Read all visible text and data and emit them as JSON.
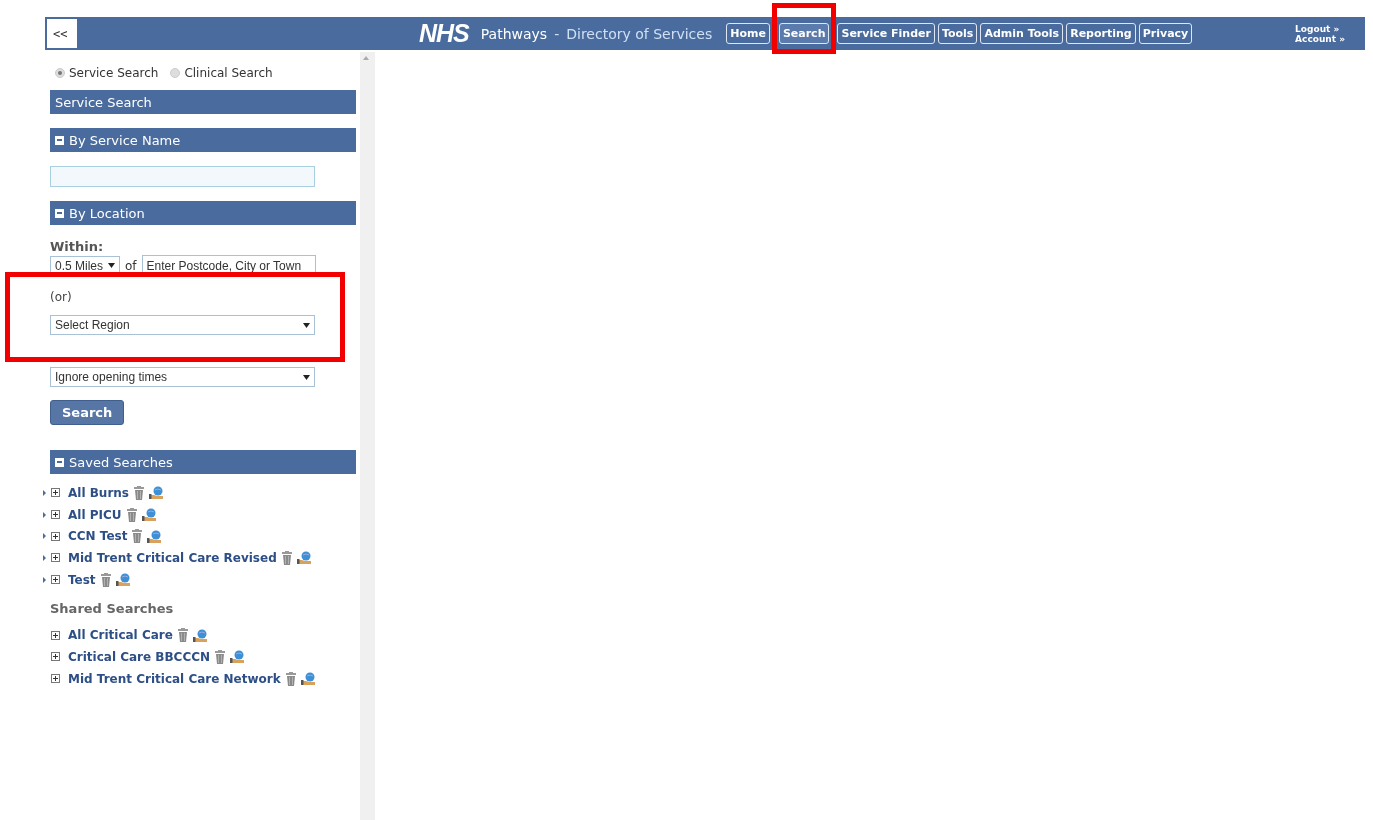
{
  "header": {
    "collapse_button": "<<",
    "logo": "NHS",
    "title": "Pathways",
    "separator": "-",
    "subtitle": "Directory of Services",
    "nav": [
      {
        "label": "Home",
        "selected": false,
        "highlighted": false
      },
      {
        "label": "Search",
        "selected": true,
        "highlighted": true
      },
      {
        "label": "Service Finder",
        "selected": false,
        "highlighted": false
      },
      {
        "label": "Tools",
        "selected": false,
        "highlighted": false
      },
      {
        "label": "Admin Tools",
        "selected": false,
        "highlighted": false
      },
      {
        "label": "Reporting",
        "selected": false,
        "highlighted": false
      },
      {
        "label": "Privacy",
        "selected": false,
        "highlighted": false
      }
    ],
    "account_links": [
      "Logout »",
      "Account »"
    ]
  },
  "search_mode": [
    {
      "label": "Service Search",
      "selected": true
    },
    {
      "label": "Clinical Search",
      "selected": false
    }
  ],
  "panel_title": "Service Search",
  "by_service_name": {
    "title": "By Service Name",
    "expanded": true
  },
  "by_location": {
    "title": "By Location",
    "expanded": true,
    "within_label": "Within:",
    "distance": "0.5 Miles",
    "of_label": "of",
    "location_placeholder": "Enter Postcode, City or Town",
    "or_label": "(or)",
    "region": "Select Region",
    "region_highlighted": true,
    "opening": "Ignore opening times"
  },
  "search_button": "Search",
  "saved_searches": {
    "title": "Saved Searches",
    "expanded": true,
    "items": [
      {
        "name": "All Burns",
        "has_arrow": true
      },
      {
        "name": "All PICU",
        "has_arrow": true
      },
      {
        "name": "CCN Test",
        "has_arrow": true
      },
      {
        "name": "Mid Trent Critical Care Revised",
        "has_arrow": true
      },
      {
        "name": "Test",
        "has_arrow": true
      }
    ]
  },
  "shared_searches": {
    "title": "Shared Searches",
    "items": [
      {
        "name": "All Critical Care",
        "has_arrow": false
      },
      {
        "name": "Critical Care BBCCCN",
        "has_arrow": false
      },
      {
        "name": "Mid Trent Critical Care Network",
        "has_arrow": false
      }
    ]
  }
}
